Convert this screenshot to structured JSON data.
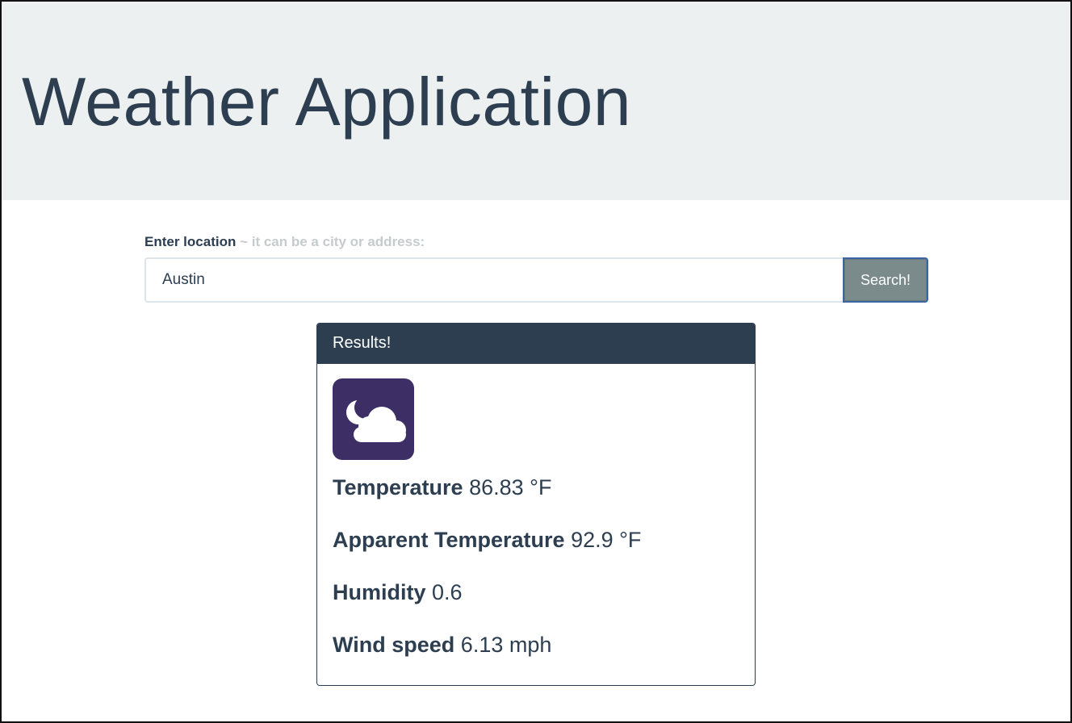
{
  "app": {
    "title": "Weather Application"
  },
  "search": {
    "label": "Enter location",
    "hint": "~ it can be a city or address:",
    "value": "Austin",
    "button_label": "Search!"
  },
  "results": {
    "header": "Results!",
    "icon": "partly-cloudy-night-icon",
    "stats": [
      {
        "label": "Temperature",
        "value": "86.83 °F"
      },
      {
        "label": "Apparent Temperature",
        "value": "92.9 °F"
      },
      {
        "label": "Humidity",
        "value": "0.6"
      },
      {
        "label": "Wind speed",
        "value": "6.13 mph"
      }
    ]
  },
  "colors": {
    "primary": "#2c3e50",
    "jumbotron_bg": "#ecf0f1",
    "button": "#7b8a8b",
    "icon_bg": "#3d2f66"
  }
}
